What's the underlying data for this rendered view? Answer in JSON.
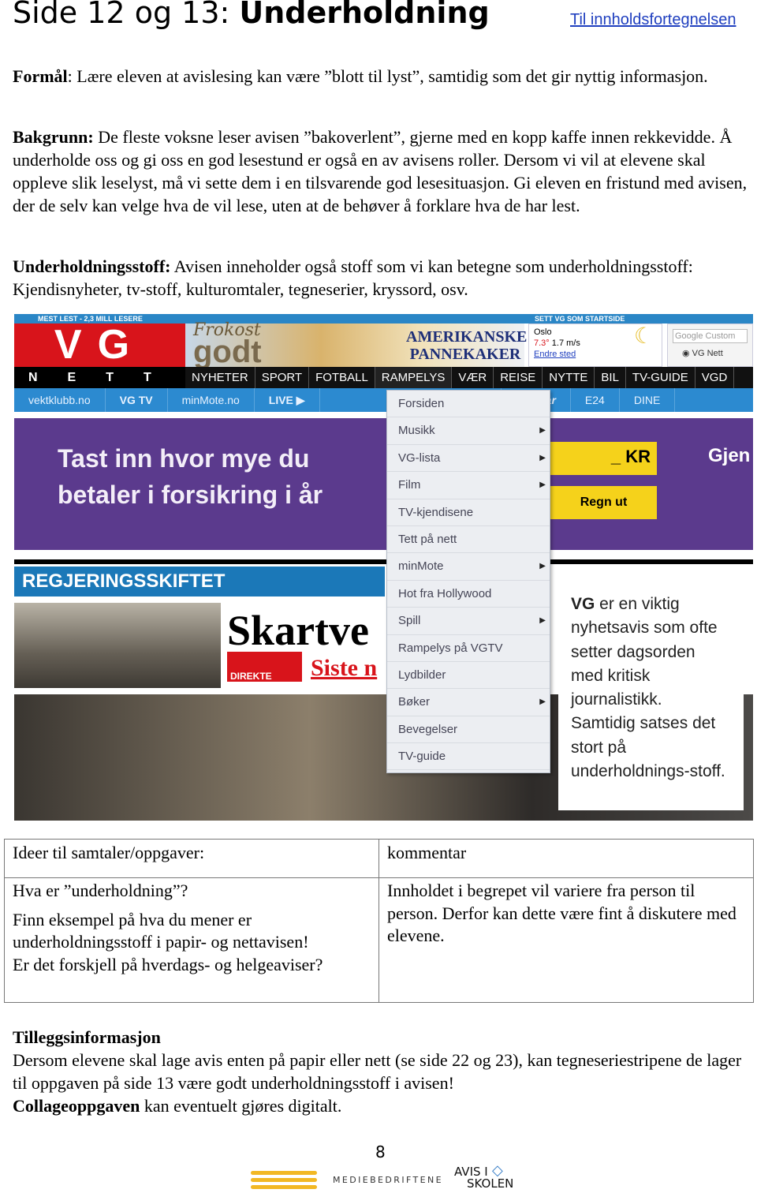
{
  "header": {
    "title_prefix": "Side 12 og 13: ",
    "title_bold": "Underholdning",
    "toc_link": "Til innholdsfortegnelsen"
  },
  "purpose": {
    "label": "Formål",
    "text": ": Lære eleven at avislesing kan være ”blott til lyst”, samtidig som det gir nyttig informasjon."
  },
  "background": {
    "label": "Bakgrunn:",
    "text": " De fleste voksne leser avisen ”bakoverlent”, gjerne med en kopp kaffe innen rekkevidde. Å underholde oss og gi oss en god lesestund er også en av avisens roller. Dersom vi vil at elevene skal oppleve slik leselyst, må vi sette dem i en tilsvarende god lesesituasjon. Gi eleven en fristund med avisen, der de selv kan velge hva de vil lese, uten at de behøver å forklare hva de har lest."
  },
  "entertainment": {
    "label": "Underholdningsstoff:",
    "text": " Avisen inneholder også stoff som vi kan betegne som underholdningsstoff:  Kjendisnyheter, tv-stoff,  kulturomtaler, tegneserier, kryssord, osv."
  },
  "screenshot": {
    "top_left": "MEST LEST - 2,3 MILL LESERE",
    "top_right": "SETT VG SOM STARTSIDE",
    "logo": "VG",
    "logo_sub": "NETT",
    "ad": {
      "line1": "Frokost",
      "line2": "godt",
      "line3": "AMERIKANSKE PANNEKAKER"
    },
    "weather": {
      "city": "Oslo",
      "temp": "7.3°",
      "wind": "1.7 m/s",
      "change": "Endre sted"
    },
    "search": {
      "placeholder": "Google Custom",
      "radio": "VG Nett"
    },
    "nav": [
      "NYHETER",
      "SPORT",
      "FOTBALL",
      "RAMPELYS",
      "VÆR",
      "REISE",
      "NYTTE",
      "BIL",
      "TV-GUIDE",
      "VGD"
    ],
    "subnav": [
      "vektklubb.no",
      "VG TV",
      "minMote.no",
      "LIVE ▶",
      "",
      "dyrebar",
      "E24",
      "DINE"
    ],
    "banner": {
      "text": "Tast inn hvor mye du betaler i forsikring i år",
      "amount": "_ KR",
      "button": "Regn ut",
      "right": "Gjen"
    },
    "section": "REGJERINGSSKIFTET",
    "headline": "Skartve",
    "live": "DIREKTE",
    "latest": "Siste n",
    "menu": [
      {
        "label": "Forsiden",
        "sub": false
      },
      {
        "label": "Musikk",
        "sub": true
      },
      {
        "label": "VG-lista",
        "sub": true
      },
      {
        "label": "Film",
        "sub": true
      },
      {
        "label": "TV-kjendisene",
        "sub": false
      },
      {
        "label": "Tett på nett",
        "sub": false
      },
      {
        "label": "minMote",
        "sub": true
      },
      {
        "label": "Hot fra Hollywood",
        "sub": false
      },
      {
        "label": "Spill",
        "sub": true
      },
      {
        "label": "Rampelys på VGTV",
        "sub": false
      },
      {
        "label": "Lydbilder",
        "sub": false
      },
      {
        "label": "Bøker",
        "sub": true
      },
      {
        "label": "Bevegelser",
        "sub": false
      },
      {
        "label": "TV-guide",
        "sub": false
      }
    ],
    "callout": {
      "bold": "VG",
      "text": " er en viktig nyhetsavis som ofte setter dagsorden med kritisk journalistikk. Samtidig satses det stort på underholdnings-stoff."
    }
  },
  "table": {
    "head": [
      "Ideer til samtaler/oppgaver:",
      "kommentar"
    ],
    "q1": "Hva er ”underholdning”?",
    "q2": "Finn eksempel på hva du mener er underholdningsstoff i papir- og nettavisen!",
    "q3": "Er det forskjell på hverdags- og helgeaviser?",
    "comment": "Innholdet i begrepet vil variere fra person til person. Derfor kan dette være fint å diskutere med elevene."
  },
  "extra": {
    "heading": "Tilleggsinformasjon",
    "text": "Dersom elevene skal lage avis enten på papir eller nett (se side 22 og 23), kan tegneseriestripene de lager til oppgaven på side 13 være godt underholdningsstoff i avisen!",
    "bold2": "Collageoppgaven",
    "text2": " kan eventuelt gjøres digitalt."
  },
  "footer": {
    "page": "8",
    "logo1": "MEDIEBEDRIFTENE",
    "logo2a": "AVIS I",
    "logo2b": "SKOLEN"
  }
}
